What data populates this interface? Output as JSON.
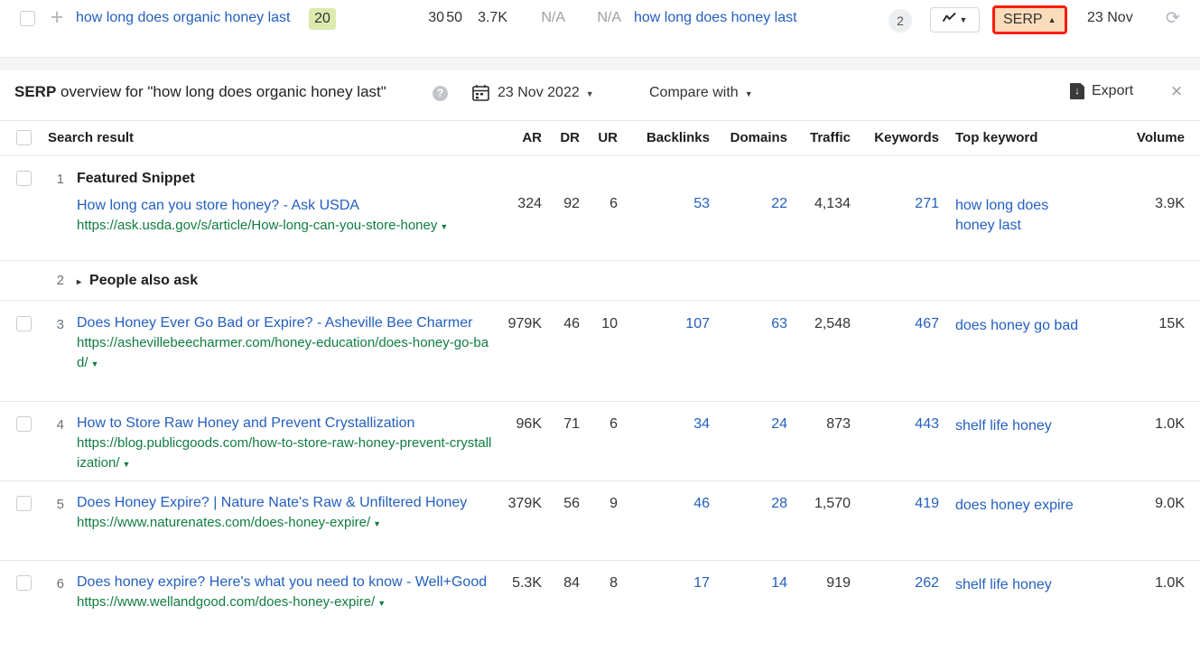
{
  "keyword_row": {
    "keyword": "how long does organic honey last",
    "kd_badge": "20",
    "kd_badge_color": "#dceaae",
    "cpc": "30",
    "cps": "50",
    "volume": "3.7K",
    "na_1": "N/A",
    "na_2": "N/A",
    "parent_topic": "how long does honey last",
    "sf_count": "2",
    "chart_icon": "line-chart-icon",
    "chart_caret": "▼",
    "serp_button": "SERP",
    "serp_caret": "▲",
    "serp_button_bg": "#fbdcba",
    "serp_button_border": "#fc1b0c",
    "date": "23 Nov",
    "refresh_icon": "refresh-icon",
    "plus_icon": "plus-icon"
  },
  "serp_header": {
    "title_bold": "SERP",
    "title_rest": " overview for \"how long does organic honey last\"",
    "help_icon": "?",
    "calendar_icon": "calendar-icon",
    "date": "23 Nov 2022",
    "caret": "▼",
    "compare_label": "Compare with",
    "export_label": "Export",
    "export_icon": "download-file-icon",
    "close_icon": "×"
  },
  "table": {
    "columns": {
      "search_result": "Search result",
      "ar": "AR",
      "dr": "DR",
      "ur": "UR",
      "backlinks": "Backlinks",
      "domains": "Domains",
      "traffic": "Traffic",
      "keywords": "Keywords",
      "top_keyword": "Top keyword",
      "volume": "Volume"
    },
    "rows": [
      {
        "rank": "1",
        "type": "featured_snippet",
        "label": "Featured Snippet",
        "title": "How long can you store honey? - Ask USDA",
        "url": "https://ask.usda.gov/s/article/How-long-can-you-store-honey",
        "url_caret": "▼",
        "ar": "324",
        "dr": "92",
        "ur": "6",
        "backlinks": "53",
        "domains": "22",
        "traffic": "4,134",
        "keywords": "271",
        "top_keyword": "how long does honey last",
        "volume": "3.9K"
      },
      {
        "rank": "2",
        "type": "people_also_ask",
        "label": "People also ask",
        "expand_arrow": "▸"
      },
      {
        "rank": "3",
        "type": "organic",
        "title": "Does Honey Ever Go Bad or Expire? - Asheville Bee Charmer",
        "url": "https://ashevillebeecharmer.com/honey-education/does-honey-go-bad/",
        "url_caret": "▼",
        "ar": "979K",
        "dr": "46",
        "ur": "10",
        "backlinks": "107",
        "domains": "63",
        "traffic": "2,548",
        "keywords": "467",
        "top_keyword": "does honey go bad",
        "volume": "15K"
      },
      {
        "rank": "4",
        "type": "organic",
        "title": "How to Store Raw Honey and Prevent Crystallization",
        "url": "https://blog.publicgoods.com/how-to-store-raw-honey-prevent-crystallization/",
        "url_caret": "▼",
        "ar": "96K",
        "dr": "71",
        "ur": "6",
        "backlinks": "34",
        "domains": "24",
        "traffic": "873",
        "keywords": "443",
        "top_keyword": "shelf life honey",
        "volume": "1.0K"
      },
      {
        "rank": "5",
        "type": "organic",
        "title": "Does Honey Expire? | Nature Nate's Raw & Unfiltered Honey",
        "url": "https://www.naturenates.com/does-honey-expire/",
        "url_caret": "▼",
        "ar": "379K",
        "dr": "56",
        "ur": "9",
        "backlinks": "46",
        "domains": "28",
        "traffic": "1,570",
        "keywords": "419",
        "top_keyword": "does honey expire",
        "volume": "9.0K"
      },
      {
        "rank": "6",
        "type": "organic",
        "title": "Does honey expire? Here's what you need to know - Well+Good",
        "url": "https://www.wellandgood.com/does-honey-expire/",
        "url_caret": "▼",
        "ar": "5.3K",
        "dr": "84",
        "ur": "8",
        "backlinks": "17",
        "domains": "14",
        "traffic": "919",
        "keywords": "262",
        "top_keyword": "shelf life honey",
        "volume": "1.0K"
      }
    ]
  }
}
